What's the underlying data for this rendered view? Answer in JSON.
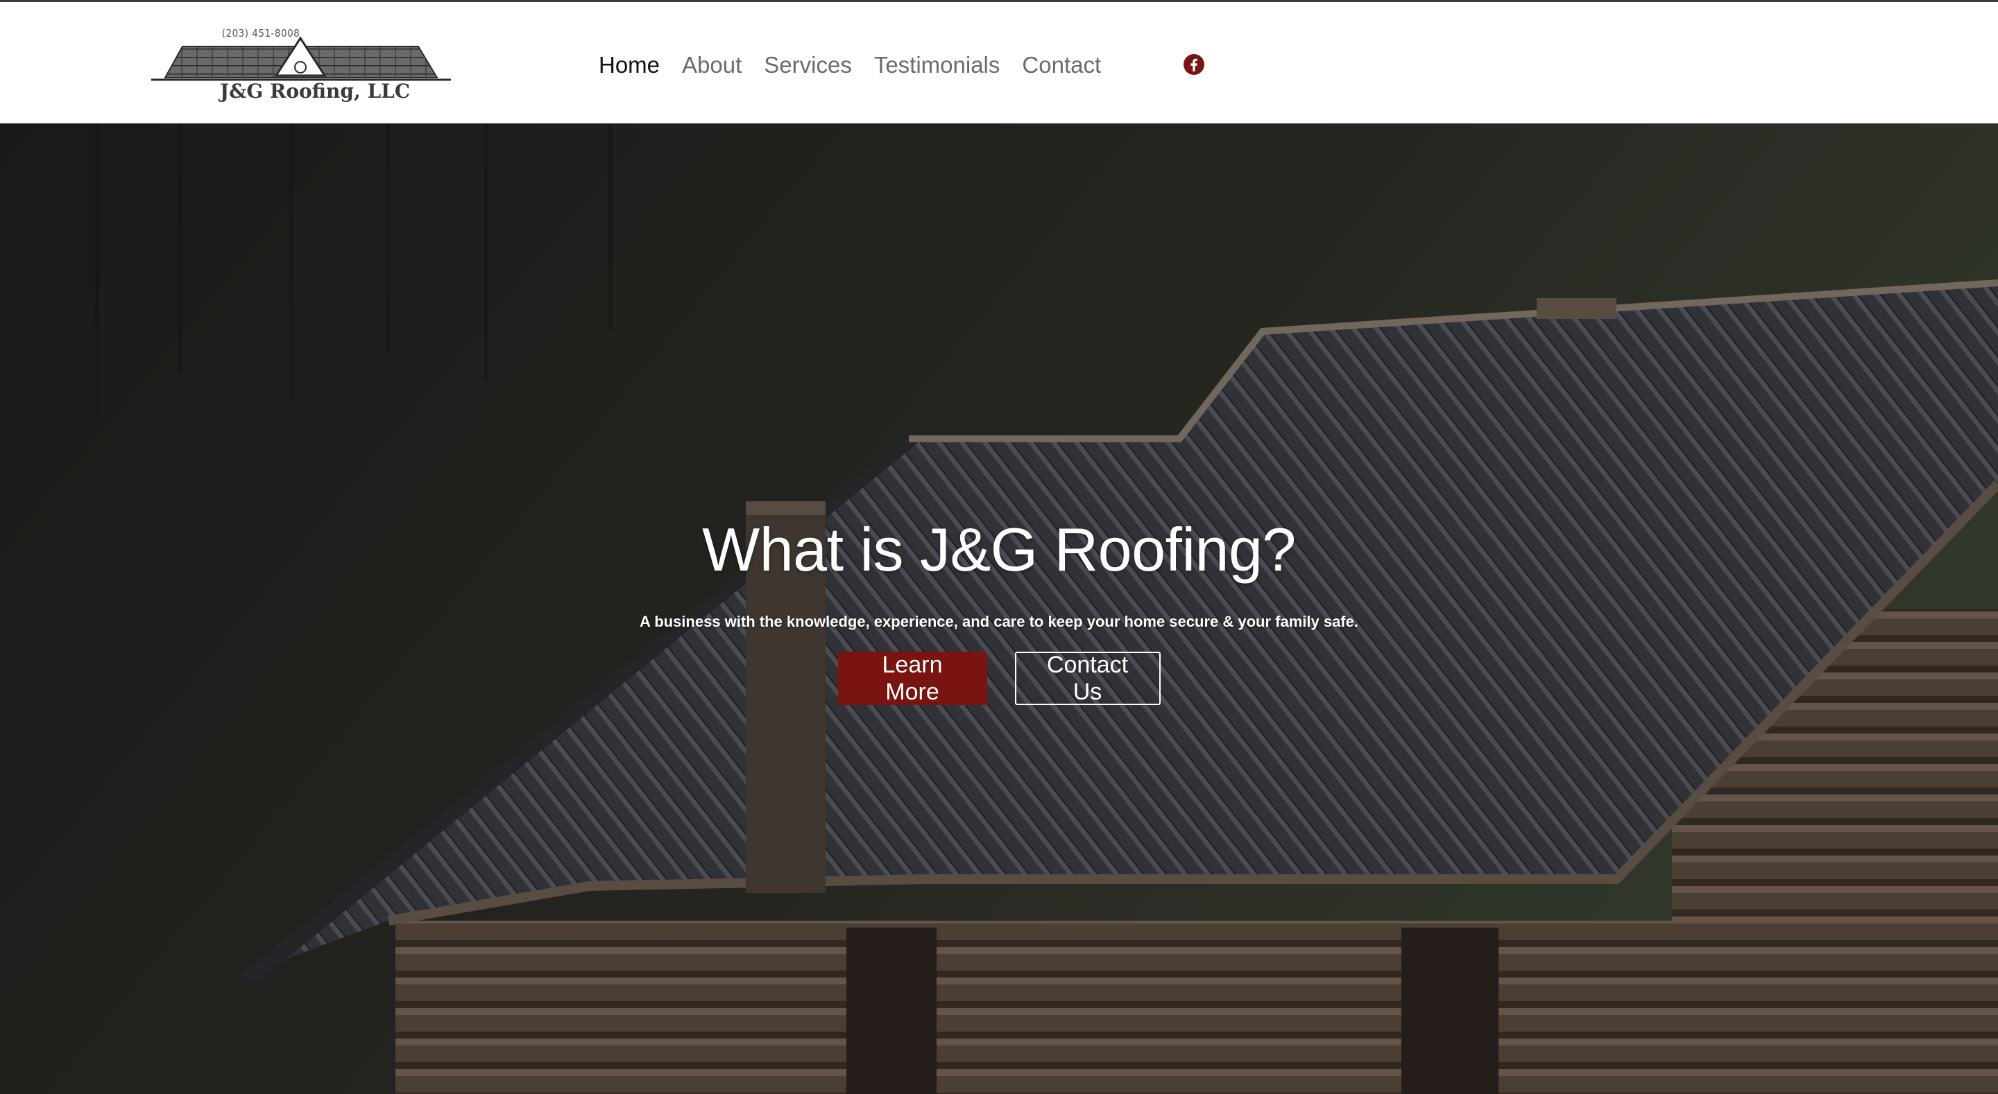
{
  "header": {
    "logo": {
      "phone": "(203) 451-8008",
      "name": "J&G Roofing, LLC"
    },
    "nav": [
      {
        "label": "Home",
        "active": true
      },
      {
        "label": "About",
        "active": false
      },
      {
        "label": "Services",
        "active": false
      },
      {
        "label": "Testimonials",
        "active": false
      },
      {
        "label": "Contact",
        "active": false
      }
    ],
    "social": {
      "icon": "facebook-icon",
      "color": "#7a1410"
    }
  },
  "hero": {
    "title": "What is J&G Roofing?",
    "subtitle": "A business with the knowledge, experience, and care to keep your home secure & your family safe.",
    "primary_button": "Learn More",
    "secondary_button": "Contact Us",
    "accent_color": "#7a1410"
  }
}
